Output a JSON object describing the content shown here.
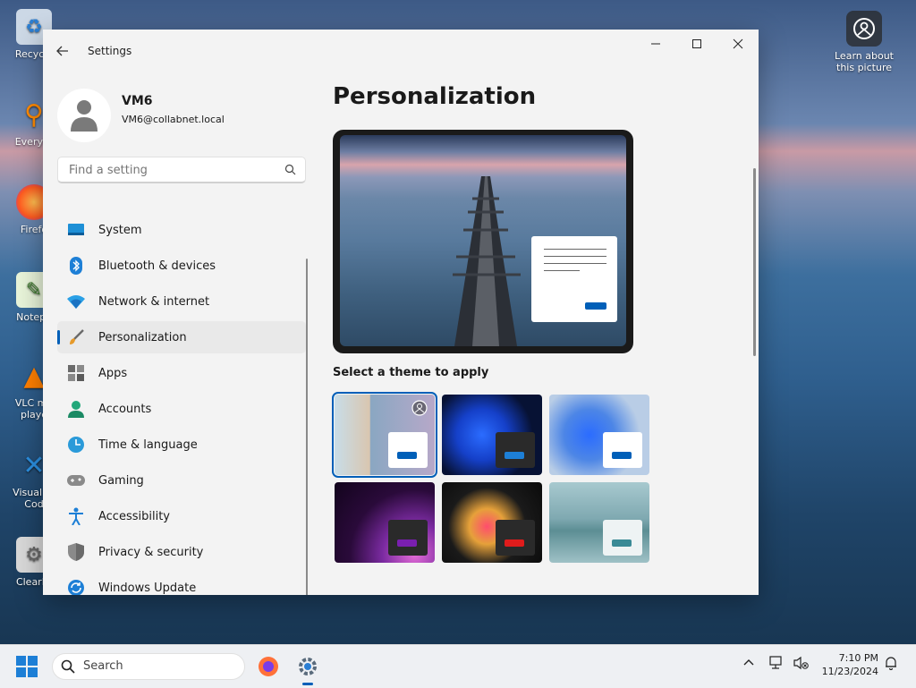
{
  "desktop": {
    "icons": [
      {
        "label": "Recycle",
        "icon": "recycle-bin-icon"
      },
      {
        "label": "Everyth",
        "icon": "everything-search-icon"
      },
      {
        "label": "Firefo",
        "icon": "firefox-icon"
      },
      {
        "label": "Notepa",
        "icon": "notepad-icon"
      },
      {
        "label": "VLC me playe",
        "icon": "vlc-icon"
      },
      {
        "label": "Visual St Cod",
        "icon": "vscode-icon"
      },
      {
        "label": "ClearHi",
        "icon": "clearhistory-icon"
      }
    ],
    "learn_label": "Learn about this picture"
  },
  "window": {
    "title": "Settings"
  },
  "profile": {
    "name": "VM6",
    "email": "VM6@collabnet.local"
  },
  "search": {
    "placeholder": "Find a setting"
  },
  "nav": {
    "items": [
      {
        "label": "System",
        "icon": "system-icon"
      },
      {
        "label": "Bluetooth & devices",
        "icon": "bluetooth-icon"
      },
      {
        "label": "Network & internet",
        "icon": "wifi-icon"
      },
      {
        "label": "Personalization",
        "icon": "brush-icon",
        "active": true
      },
      {
        "label": "Apps",
        "icon": "apps-icon"
      },
      {
        "label": "Accounts",
        "icon": "accounts-icon"
      },
      {
        "label": "Time & language",
        "icon": "time-language-icon"
      },
      {
        "label": "Gaming",
        "icon": "gamepad-icon"
      },
      {
        "label": "Accessibility",
        "icon": "accessibility-icon"
      },
      {
        "label": "Privacy & security",
        "icon": "shield-icon"
      },
      {
        "label": "Windows Update",
        "icon": "windows-update-icon"
      }
    ]
  },
  "content": {
    "title": "Personalization",
    "theme_label": "Select a theme to apply",
    "themes": [
      {
        "name": "spotlight",
        "selected": true
      },
      {
        "name": "dark-bloom"
      },
      {
        "name": "light-bloom"
      },
      {
        "name": "glow"
      },
      {
        "name": "captured-motion"
      },
      {
        "name": "flow"
      }
    ]
  },
  "taskbar": {
    "search_label": "Search",
    "time": "7:10 PM",
    "date": "11/23/2024"
  },
  "colors": {
    "accent": "#005fb8"
  }
}
